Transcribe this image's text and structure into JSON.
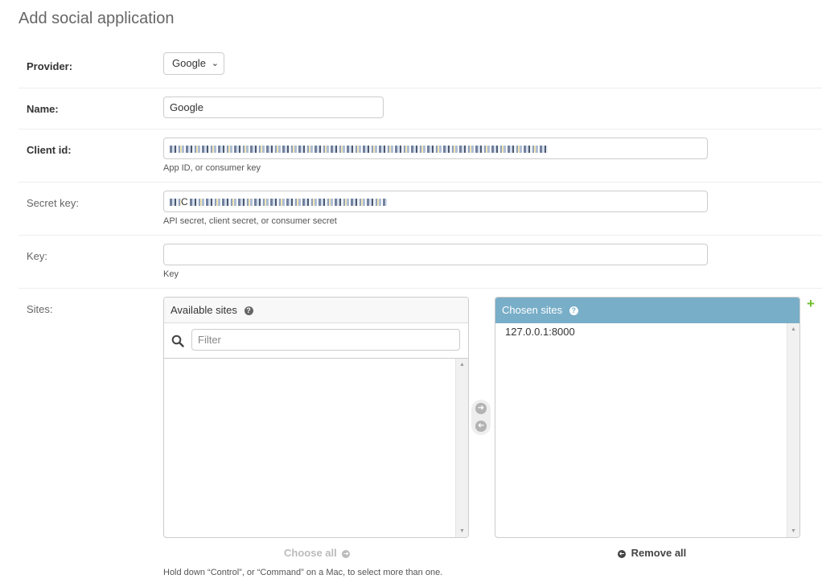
{
  "page": {
    "title": "Add social application"
  },
  "fields": {
    "provider": {
      "label": "Provider:",
      "value": "Google"
    },
    "name": {
      "label": "Name:",
      "value": "Google"
    },
    "client_id": {
      "label": "Client id:",
      "help": "App ID, or consumer key"
    },
    "secret_key": {
      "label": "Secret key:",
      "value_prefix": "C",
      "help": "API secret, client secret, or consumer secret"
    },
    "key": {
      "label": "Key:",
      "value": "",
      "help": "Key"
    },
    "sites": {
      "label": "Sites:"
    }
  },
  "selector": {
    "available_title": "Available sites",
    "filter_placeholder": "Filter",
    "chosen_title": "Chosen sites",
    "chosen_items": [
      "127.0.0.1:8000"
    ],
    "choose_all": "Choose all",
    "remove_all": "Remove all",
    "help_text": "Hold down “Control”, or “Command” on a Mac, to select more than one."
  },
  "icons": {
    "help": "question-circle-icon",
    "search": "search-icon",
    "add": "plus-icon",
    "move_right": "arrow-right-circle-icon",
    "move_left": "arrow-left-circle-icon"
  },
  "colors": {
    "chosen_header": "#79aec8",
    "add_icon": "#70bf2b"
  }
}
